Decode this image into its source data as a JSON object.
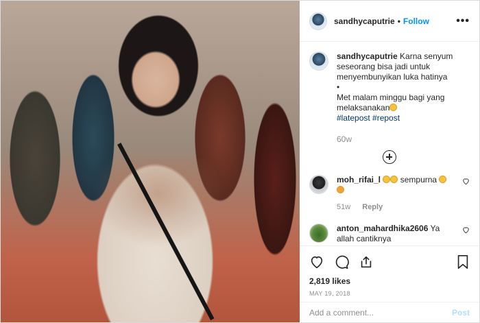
{
  "post": {
    "username": "sandhycaputrie",
    "separator": "•",
    "follow_label": "Follow",
    "more_label": "•••"
  },
  "caption": {
    "username": "sandhycaputrie",
    "line1": "Karna senyum seseorang bisa jadi untuk menyembunyikan luka hatinya",
    "bullet": "•",
    "line2": "Met malam minggu bagi yang melaksanakan",
    "tags": "#latepost #repost",
    "time": "60w"
  },
  "comments": [
    {
      "username": "moh_rifai_l",
      "text_after": "sempurna",
      "time": "51w",
      "reply_label": "Reply"
    },
    {
      "username": "anton_mahardhika2606",
      "text": "Ya allah cantiknya"
    }
  ],
  "actions": {
    "likes": "2,819 likes",
    "date": "May 19, 2018"
  },
  "add_comment": {
    "placeholder": "Add a comment...",
    "post_label": "Post"
  },
  "icons": [
    "heart-icon",
    "comment-icon",
    "share-icon",
    "bookmark-icon",
    "plus-circle-icon",
    "more-icon"
  ],
  "colors": {
    "follow": "#0095f6",
    "post_button": "#b2dffc",
    "muted": "#8e8e8e",
    "hashtag": "#00376b"
  }
}
